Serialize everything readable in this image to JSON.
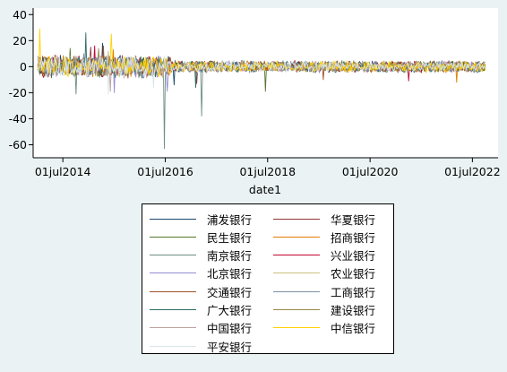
{
  "chart_data": {
    "type": "line",
    "title": "",
    "xlabel": "date1",
    "ylabel": "",
    "ylim": [
      -70,
      45
    ],
    "y_ticks": [
      "40",
      "20",
      "0",
      "-20",
      "-40",
      "-60"
    ],
    "y_tick_values": [
      40,
      20,
      0,
      -20,
      -40,
      -60
    ],
    "x_ticks": [
      "01jul2014",
      "01jul2016",
      "01jul2018",
      "01jul2020",
      "01jul2022"
    ],
    "x_tick_values": [
      "2014-07-01",
      "2016-07-01",
      "2018-07-01",
      "2020-07-01",
      "2022-07-01"
    ],
    "xlim": [
      "2013-12-01",
      "2022-12-31"
    ],
    "grid": false,
    "legend_position": "bottom",
    "series": [
      {
        "name": "浦发银行",
        "color": "#1a476f",
        "spikes": [
          [
            "2015-04-10",
            18
          ],
          [
            "2016-09-05",
            -14
          ]
        ]
      },
      {
        "name": "华夏银行",
        "color": "#90353b",
        "spikes": [
          [
            "2015-01-15",
            15
          ],
          [
            "2017-02-10",
            -13
          ]
        ]
      },
      {
        "name": "民生银行",
        "color": "#55752f",
        "spikes": [
          [
            "2014-08-20",
            14
          ],
          [
            "2018-06-15",
            -19
          ]
        ]
      },
      {
        "name": "招商银行",
        "color": "#e37e00",
        "spikes": [
          [
            "2015-06-25",
            13
          ],
          [
            "2022-03-10",
            -12
          ]
        ]
      },
      {
        "name": "南京银行",
        "color": "#6e8e84",
        "spikes": [
          [
            "2016-06-25",
            -63
          ],
          [
            "2017-03-20",
            -38
          ],
          [
            "2014-10-01",
            -21
          ]
        ]
      },
      {
        "name": "兴业银行",
        "color": "#c10534",
        "spikes": [
          [
            "2015-02-12",
            16
          ],
          [
            "2021-04-05",
            -11
          ]
        ]
      },
      {
        "name": "北京银行",
        "color": "#938dd2",
        "spikes": [
          [
            "2015-06-30",
            -20
          ],
          [
            "2016-07-15",
            -19
          ]
        ]
      },
      {
        "name": "农业银行",
        "color": "#cac27e",
        "spikes": [
          [
            "2015-05-20",
            12
          ]
        ]
      },
      {
        "name": "交通银行",
        "color": "#a0522d",
        "spikes": [
          [
            "2015-04-20",
            16
          ],
          [
            "2019-08-01",
            -10
          ]
        ]
      },
      {
        "name": "工商银行",
        "color": "#7b92a8",
        "spikes": [
          [
            "2014-11-25",
            10
          ]
        ]
      },
      {
        "name": "广大银行",
        "color": "#2d6d66",
        "spikes": [
          [
            "2014-12-10",
            26
          ],
          [
            "2017-02-05",
            -16
          ]
        ]
      },
      {
        "name": "建设银行",
        "color": "#9c8847",
        "spikes": [
          [
            "2015-03-10",
            14
          ]
        ]
      },
      {
        "name": "中国银行",
        "color": "#bfa19c",
        "spikes": [
          [
            "2015-06-05",
            -19
          ]
        ]
      },
      {
        "name": "中信银行",
        "color": "#ffd200",
        "spikes": [
          [
            "2014-01-15",
            29
          ],
          [
            "2015-06-10",
            25
          ]
        ]
      },
      {
        "name": "平安银行",
        "color": "#d9e6eb",
        "spikes": [
          [
            "2015-05-25",
            -21
          ],
          [
            "2016-04-10",
            -16
          ]
        ]
      }
    ]
  }
}
